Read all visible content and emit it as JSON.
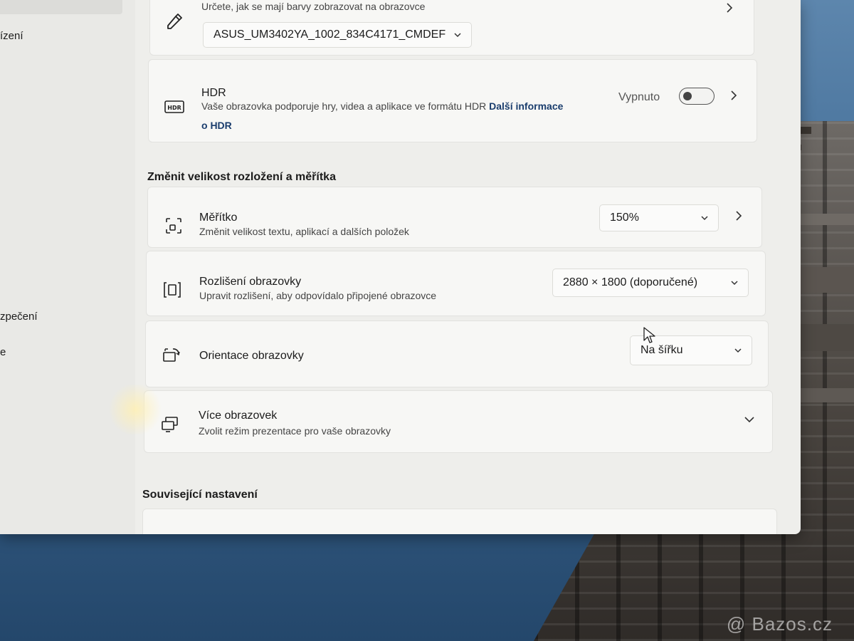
{
  "sidebar": {
    "items": [
      "ízení",
      "zpečení",
      "e"
    ]
  },
  "color_profile": {
    "description": "Určete, jak se mají barvy zobrazovat na obrazovce",
    "selected_profile": "ASUS_UM3402YA_1002_834C4171_CMDEF",
    "icon": "eyedropper-icon"
  },
  "hdr": {
    "title": "HDR",
    "description": "Vaše obrazovka podporuje hry, videa a aplikace ve formátu HDR",
    "link_part1": "Další informace",
    "link_part2": "o HDR",
    "toggle_label": "Vypnuto",
    "toggle_on": false,
    "icon": "hdr-icon"
  },
  "scale_section": {
    "heading": "Změnit velikost rozložení a měřítka",
    "scale": {
      "title": "Měřítko",
      "description": "Změnit velikost textu, aplikací a dalších položek",
      "value": "150%",
      "icon": "scale-icon"
    },
    "resolution": {
      "title": "Rozlišení obrazovky",
      "description": "Upravit rozlišení, aby odpovídalo připojené obrazovce",
      "value": "2880 × 1800 (doporučené)",
      "icon": "resolution-icon"
    },
    "orientation": {
      "title": "Orientace obrazovky",
      "value": "Na šířku",
      "icon": "orientation-icon"
    },
    "multiple": {
      "title": "Více obrazovek",
      "description": "Zvolit režim prezentace pro vaše obrazovky",
      "icon": "multiple-displays-icon"
    }
  },
  "related": {
    "heading": "Související nastavení"
  },
  "watermark": "@ Bazos.cz",
  "colors": {
    "window_bg": "#eeeeeb",
    "card_bg": "#f7f7f5",
    "link": "#1a3d6d"
  }
}
